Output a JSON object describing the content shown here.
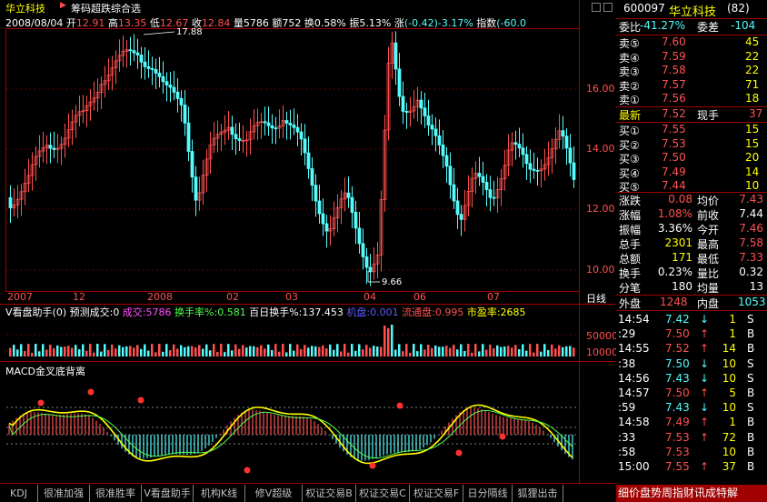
{
  "header": {
    "stock_name": "华立科技",
    "indicator_name": "筹码超跌综合选"
  },
  "ohlc": {
    "date": "2008/08/04",
    "open_l": "开",
    "open": "12.91",
    "high_l": "高",
    "high": "13.35",
    "low_l": "低",
    "low": "12.67",
    "close_l": "收",
    "close": "12.84",
    "vol_l": "量",
    "vol": "5786",
    "amt_l": "额",
    "amt": "752",
    "turn_l": "换",
    "turn": "0.58%",
    "amp_l": "振",
    "amp": "5.13%",
    "chg_l": "涨",
    "chg": "(-0.42)-3.17%",
    "idx_l": "指数",
    "idx": "(-60.0"
  },
  "price_axis": [
    "16.00",
    "14.00",
    "12.00",
    "10.00"
  ],
  "price_marks": {
    "high": "17.88",
    "low": "9.66"
  },
  "time_axis": [
    "2007",
    "12",
    "2008",
    "02",
    "03",
    "04",
    "06",
    "07"
  ],
  "period_label": "日线",
  "vol_panel": {
    "title": "V看盘助手(0)",
    "predict_l": "预测成交:0",
    "vol_l": "成交:",
    "vol": "5786",
    "turn_l": "换手率%:",
    "turn": "0.581",
    "day100_l": "百日换手%:",
    "day100": "137.453",
    "inst_l": "机盘:",
    "inst": "0.001",
    "circ_l": "流通盘:",
    "circ": "0.995",
    "pe_l": "市盈率:",
    "pe": "2685",
    "axis": "50000",
    "axis2": "10000"
  },
  "macd_panel": {
    "title": "MACD金叉底背离"
  },
  "quote": {
    "code": "600097",
    "name": "华立科技",
    "count": "(82)",
    "wb_l": "委比",
    "wb": "-41.27%",
    "wc_l": "委差",
    "wc": "-104",
    "sell": [
      {
        "l": "卖⑤",
        "p": "7.60",
        "v": "45"
      },
      {
        "l": "卖④",
        "p": "7.59",
        "v": "22"
      },
      {
        "l": "卖③",
        "p": "7.58",
        "v": "22"
      },
      {
        "l": "卖②",
        "p": "7.57",
        "v": "71"
      },
      {
        "l": "卖①",
        "p": "7.56",
        "v": "18"
      }
    ],
    "last_l": "最新",
    "last": "7.52",
    "hand_l": "现手",
    "hand": "37",
    "buy": [
      {
        "l": "买①",
        "p": "7.55",
        "v": "15"
      },
      {
        "l": "买②",
        "p": "7.53",
        "v": "15"
      },
      {
        "l": "买③",
        "p": "7.50",
        "v": "20"
      },
      {
        "l": "买④",
        "p": "7.49",
        "v": "14"
      },
      {
        "l": "买⑤",
        "p": "7.44",
        "v": "10"
      }
    ],
    "stats": [
      {
        "l1": "涨跌",
        "v1": "0.08",
        "l2": "均价",
        "v2": "7.43"
      },
      {
        "l1": "涨幅",
        "v1": "1.08%",
        "l2": "前收",
        "v2": "7.44"
      },
      {
        "l1": "振幅",
        "v1": "3.36%",
        "l2": "今开",
        "v2": "7.46"
      },
      {
        "l1": "总手",
        "v1": "2301",
        "l2": "最高",
        "v2": "7.58"
      },
      {
        "l1": "总额",
        "v1": "171",
        "l2": "最低",
        "v2": "7.33"
      },
      {
        "l1": "换手",
        "v1": "0.23%",
        "l2": "量比",
        "v2": "0.32"
      },
      {
        "l1": "分笔",
        "v1": "180",
        "l2": "均量",
        "v2": "13"
      }
    ],
    "outer_l": "外盘",
    "outer": "1248",
    "inner_l": "内盘",
    "inner": "1053"
  },
  "ticks": [
    {
      "t": "14:54",
      "p": "7.42",
      "a": "↓",
      "v": "1",
      "s": "S"
    },
    {
      "t": ":29",
      "p": "7.50",
      "a": "↑",
      "v": "1",
      "s": "B"
    },
    {
      "t": "14:55",
      "p": "7.52",
      "a": "↑",
      "v": "14",
      "s": "B"
    },
    {
      "t": ":38",
      "p": "7.50",
      "a": "↓",
      "v": "10",
      "s": "S"
    },
    {
      "t": "14:56",
      "p": "7.43",
      "a": "↓",
      "v": "10",
      "s": "S"
    },
    {
      "t": "14:57",
      "p": "7.50",
      "a": "↑",
      "v": "5",
      "s": "B"
    },
    {
      "t": ":59",
      "p": "7.43",
      "a": "↓",
      "v": "10",
      "s": "S"
    },
    {
      "t": "14:58",
      "p": "7.49",
      "a": "↑",
      "v": "1",
      "s": "B"
    },
    {
      "t": ":33",
      "p": "7.53",
      "a": "↑",
      "v": "72",
      "s": "B"
    },
    {
      "t": ":58",
      "p": "7.53",
      "a": "",
      "v": "10",
      "s": "B"
    },
    {
      "t": "15:00",
      "p": "7.55",
      "a": "↑",
      "v": "37",
      "s": "B"
    }
  ],
  "tabs": [
    "KDJ",
    "很准加强",
    "很准胜率",
    "V看盘助手",
    "机构K线",
    "修V超级MACD",
    "权证交易B",
    "权证交易C",
    "权证交易F",
    "日分隔线",
    "狐狸出击"
  ],
  "bottom_right": "细价盘势周指财讯成特解",
  "colors": {
    "up": "#ff5050",
    "down": "#54fcfc",
    "bg": "#000000",
    "grid": "#a00000"
  }
}
